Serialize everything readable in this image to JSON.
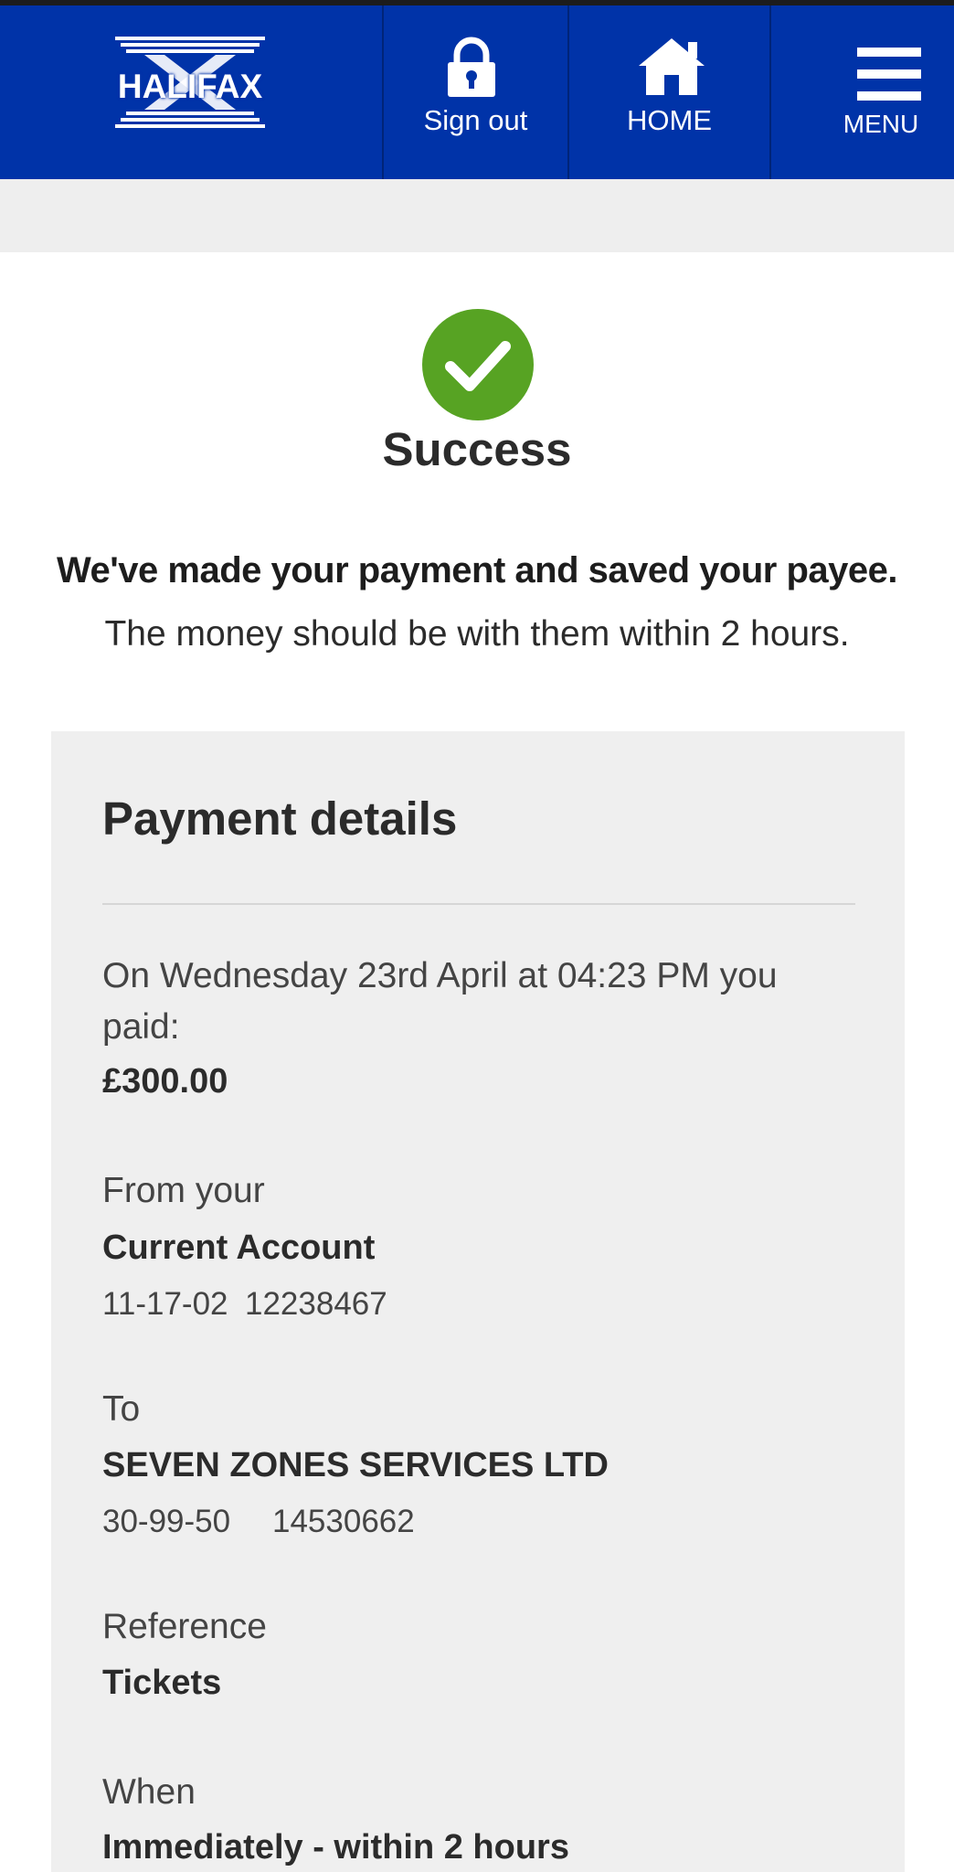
{
  "colors": {
    "brand_blue": "#0033a8",
    "success_green": "#57a323",
    "panel_bg": "#efefef",
    "band_bg": "#eeeeee"
  },
  "header": {
    "logo_text": "HALIFAX",
    "sign_out": {
      "label": "Sign out",
      "icon": "lock-icon"
    },
    "home": {
      "label": "HOME",
      "icon": "home-icon"
    },
    "menu": {
      "label": "MENU",
      "icon": "hamburger-icon"
    }
  },
  "status": {
    "icon": "check-circle-icon",
    "title": "Success",
    "message_bold": "We've made your payment and saved your payee.",
    "message": "The money should be with them within 2 hours."
  },
  "payment_details": {
    "title": "Payment details",
    "intro": "On Wednesday 23rd April at 04:23 PM you paid:",
    "amount": "£300.00",
    "from": {
      "label": "From your",
      "account_name": "Current Account",
      "sort_code": "11-17-02",
      "account_number": "12238467"
    },
    "to": {
      "label": "To",
      "payee_name": "SEVEN ZONES SERVICES LTD",
      "sort_code": "30-99-50",
      "account_number": "14530662"
    },
    "reference": {
      "label": "Reference",
      "value": "Tickets"
    },
    "when": {
      "label": "When",
      "value": "Immediately - within 2 hours"
    }
  }
}
